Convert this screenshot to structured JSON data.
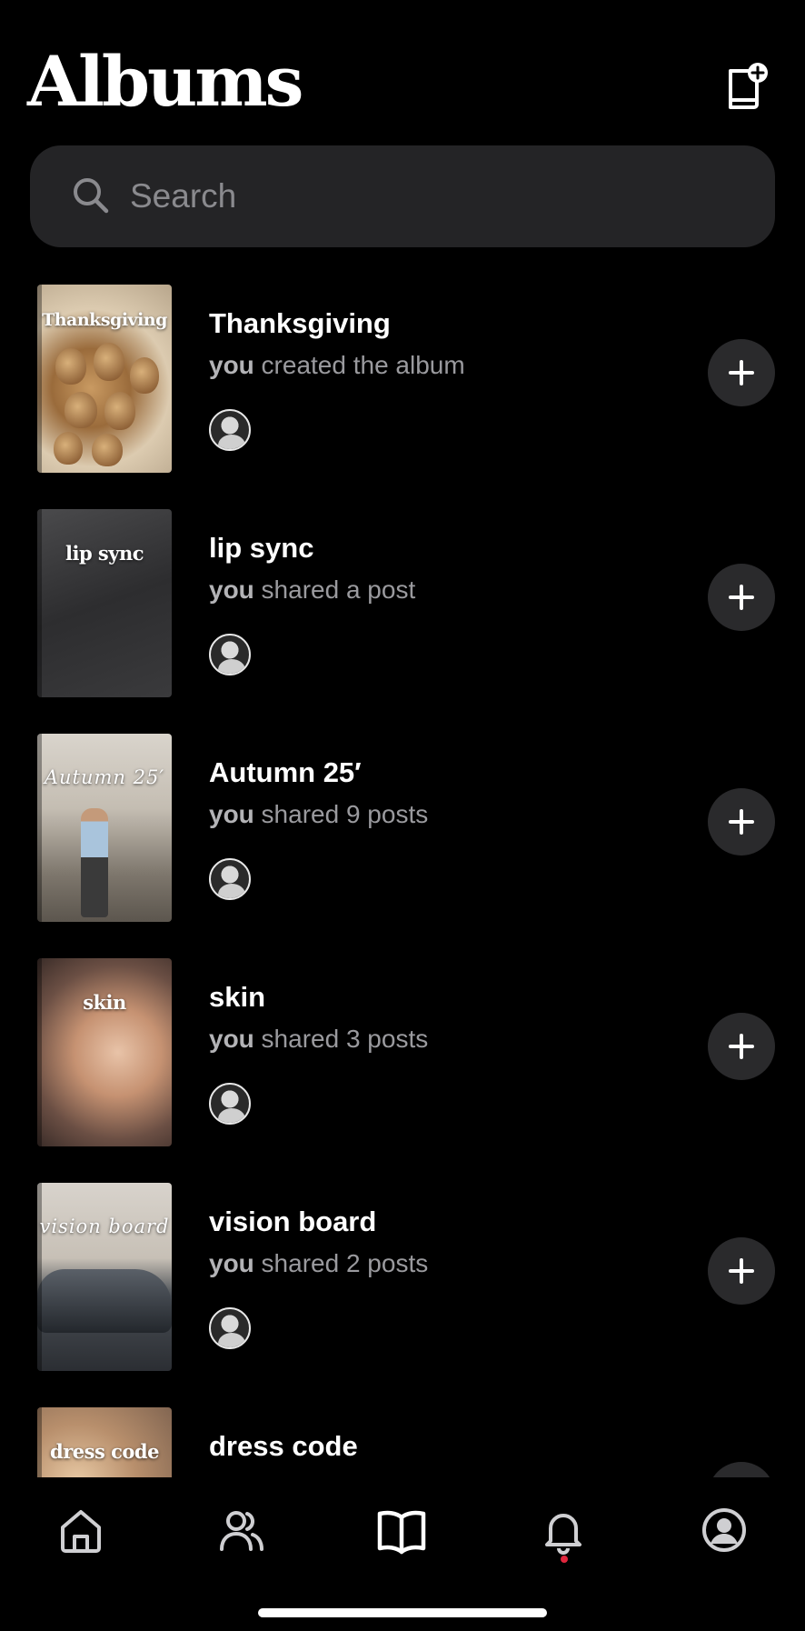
{
  "header": {
    "title": "Albums",
    "new_album_icon": "album-add-icon"
  },
  "search": {
    "placeholder": "Search",
    "value": "",
    "icon": "search-icon"
  },
  "albums": [
    {
      "name": "Thanksgiving",
      "cover_text": "Thanksgiving",
      "actor": "you",
      "activity": " created the album"
    },
    {
      "name": "lip sync",
      "cover_text": "lip sync",
      "actor": "you",
      "activity": " shared a post"
    },
    {
      "name": "Autumn 25′",
      "cover_text": "Autumn 25′",
      "actor": "you",
      "activity": " shared 9 posts"
    },
    {
      "name": "skin",
      "cover_text": "skin",
      "actor": "you",
      "activity": " shared 3 posts"
    },
    {
      "name": "vision board",
      "cover_text": "vision board",
      "actor": "you",
      "activity": " shared 2 posts"
    },
    {
      "name": "dress code",
      "cover_text": "dress code",
      "actor": "",
      "activity": ""
    }
  ],
  "tabbar": {
    "items": [
      {
        "id": "home",
        "icon": "home-icon"
      },
      {
        "id": "friends",
        "icon": "people-icon"
      },
      {
        "id": "albums",
        "icon": "book-icon",
        "active": true
      },
      {
        "id": "notifications",
        "icon": "bell-icon",
        "has_badge": true
      },
      {
        "id": "profile",
        "icon": "profile-icon"
      }
    ],
    "badge_color": "#e0263d"
  },
  "colors": {
    "background": "#000000",
    "search_bg": "#242426",
    "button_bg": "#2a2a2c",
    "muted_text": "#9a9a9e"
  }
}
